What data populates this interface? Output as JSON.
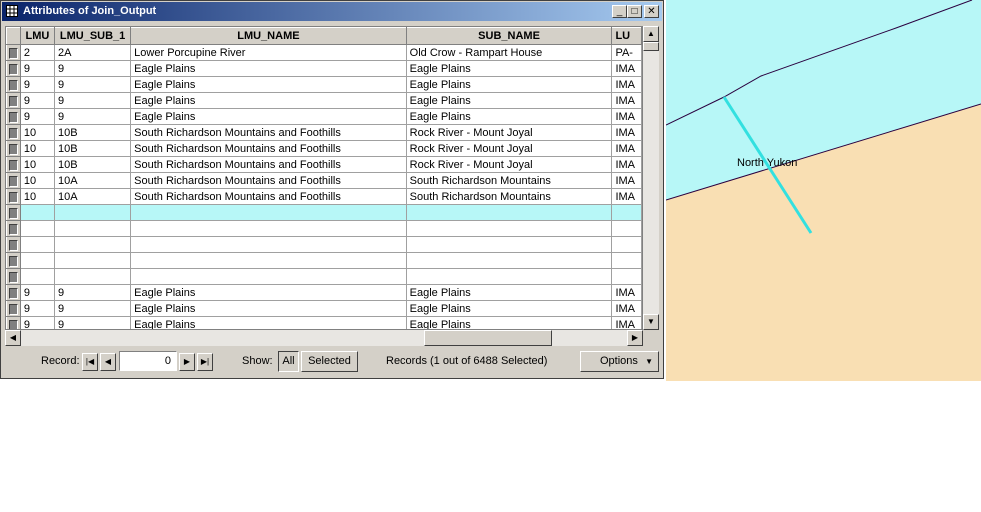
{
  "window": {
    "title": "Attributes of Join_Output",
    "controls": {
      "minimize": "_",
      "maximize": "□",
      "close": "✕"
    }
  },
  "table": {
    "columns": [
      "LMU",
      "LMU_SUB_1",
      "LMU_NAME",
      "SUB_NAME",
      "LU"
    ],
    "rows": [
      [
        "2",
        "2A",
        "Lower Porcupine River",
        "Old Crow - Rampart House",
        "PA-"
      ],
      [
        "9",
        "9",
        "Eagle Plains",
        "Eagle Plains",
        "IMA"
      ],
      [
        "9",
        "9",
        "Eagle Plains",
        "Eagle Plains",
        "IMA"
      ],
      [
        "9",
        "9",
        "Eagle Plains",
        "Eagle Plains",
        "IMA"
      ],
      [
        "9",
        "9",
        "Eagle Plains",
        "Eagle Plains",
        "IMA"
      ],
      [
        "10",
        "10B",
        "South Richardson Mountains and Foothills",
        "Rock River - Mount Joyal",
        "IMA"
      ],
      [
        "10",
        "10B",
        "South Richardson Mountains and Foothills",
        "Rock River - Mount Joyal",
        "IMA"
      ],
      [
        "10",
        "10B",
        "South Richardson Mountains and Foothills",
        "Rock River - Mount Joyal",
        "IMA"
      ],
      [
        "10",
        "10A",
        "South Richardson Mountains and Foothills",
        "South Richardson Mountains",
        "IMA"
      ],
      [
        "10",
        "10A",
        "South Richardson Mountains and Foothills",
        "South Richardson Mountains",
        "IMA"
      ],
      [
        "",
        "",
        "",
        "",
        ""
      ],
      [
        "",
        "",
        "",
        "",
        ""
      ],
      [
        "",
        "",
        "",
        "",
        ""
      ],
      [
        "",
        "",
        "",
        "",
        ""
      ],
      [
        "",
        "",
        "",
        "",
        ""
      ],
      [
        "9",
        "9",
        "Eagle Plains",
        "Eagle Plains",
        "IMA"
      ],
      [
        "9",
        "9",
        "Eagle Plains",
        "Eagle Plains",
        "IMA"
      ],
      [
        "9",
        "9",
        "Eagle Plains",
        "Eagle Plains",
        "IMA"
      ]
    ],
    "highlighted_row": 10
  },
  "toolbar": {
    "record_label": "Record:",
    "record_value": "0",
    "show_label": "Show:",
    "all_label": "All",
    "selected_label": "Selected",
    "status": "Records (1 out of 6488 Selected)",
    "options_label": "Options"
  },
  "map": {
    "label": "North Yukon",
    "colors": {
      "water": "#b7f7f7",
      "land": "#f9dfb3",
      "line": "#2a003f",
      "selection": "#33e0e0"
    }
  },
  "colors": {
    "titlebar": "#0a246a",
    "highlight": "#b7f7f7",
    "chrome": "#d4d0c8"
  }
}
